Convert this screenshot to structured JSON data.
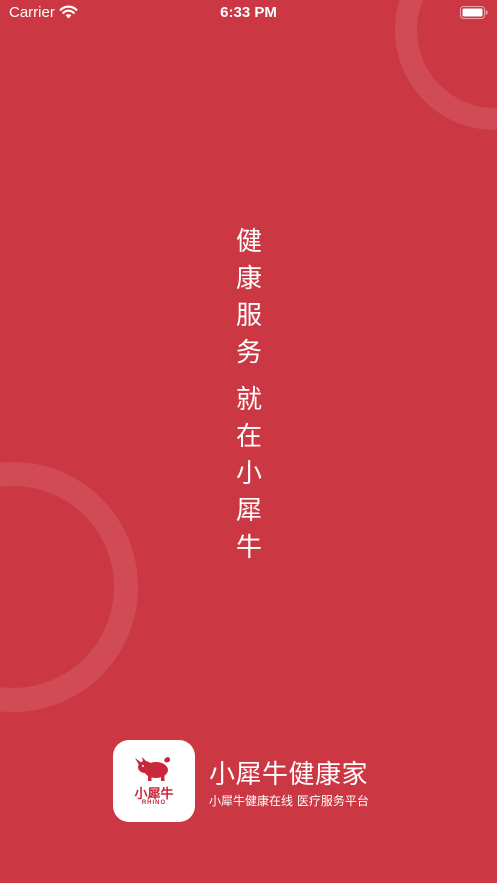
{
  "status_bar": {
    "carrier": "Carrier",
    "time": "6:33 PM",
    "wifi_icon": "wifi-icon",
    "battery_icon": "battery-icon"
  },
  "slogan": {
    "line1": "健康服务",
    "line2": "就在小犀牛"
  },
  "brand": {
    "logo_text_cn": "小犀牛",
    "logo_text_en": "RHINO",
    "name": "小犀牛健康家",
    "tagline": "小犀牛健康在线  医疗服务平台"
  },
  "colors": {
    "background": "#cc3744",
    "text": "#ffffff",
    "logo_red": "#c8283a"
  }
}
